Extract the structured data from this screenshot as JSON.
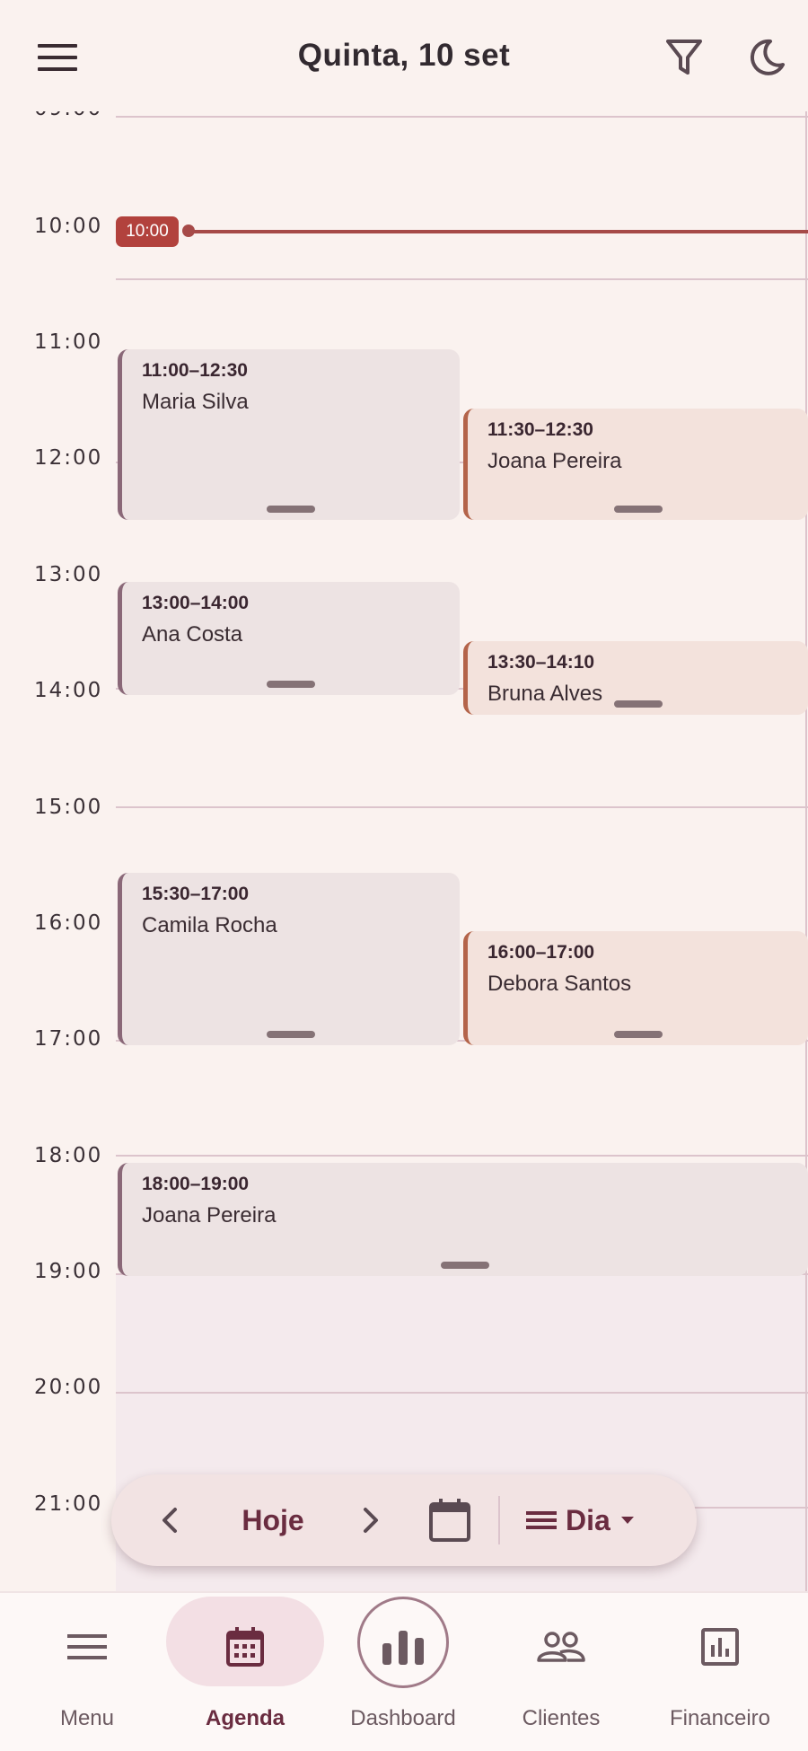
{
  "header": {
    "title": "Quinta, 10 set",
    "menu_icon": "hamburger-menu-icon",
    "filter_icon": "filter-icon",
    "theme_icon": "moon-icon"
  },
  "calendar": {
    "hours": [
      "09:00",
      "10:00",
      "11:00",
      "12:00",
      "13:00",
      "14:00",
      "15:00",
      "16:00",
      "17:00",
      "18:00",
      "19:00",
      "20:00",
      "21:00"
    ],
    "now_label": "10:00",
    "events": [
      {
        "time": "11:00–12:30",
        "name": "Maria Silva"
      },
      {
        "time": "11:30–12:30",
        "name": "Joana Pereira"
      },
      {
        "time": "13:00–14:00",
        "name": "Ana Costa"
      },
      {
        "time": "13:30–14:10",
        "name": "Bruna Alves"
      },
      {
        "time": "15:30–17:00",
        "name": "Camila Rocha"
      },
      {
        "time": "16:00–17:00",
        "name": "Debora Santos"
      },
      {
        "time": "18:00–19:00",
        "name": "Joana Pereira"
      }
    ]
  },
  "controls": {
    "today_label": "Hoje",
    "view_label": "Dia",
    "prev_icon": "chevron-left-icon",
    "next_icon": "chevron-right-icon",
    "calendar_icon": "calendar-icon",
    "view_icon": "view-list-icon",
    "dropdown_icon": "caret-down-icon"
  },
  "nav": {
    "items": [
      {
        "label": "Menu",
        "icon": "menu-icon"
      },
      {
        "label": "Agenda",
        "icon": "calendar-icon"
      },
      {
        "label": "Dashboard",
        "icon": "bar-chart-icon"
      },
      {
        "label": "Clientes",
        "icon": "people-icon"
      },
      {
        "label": "Financeiro",
        "icon": "report-icon"
      }
    ],
    "active": "Agenda"
  },
  "colors": {
    "background": "#faf2ef",
    "accent": "#6a2c40",
    "now_indicator": "#a64a48",
    "event_a": "#ede3e3",
    "event_b": "#f3e2dc"
  }
}
